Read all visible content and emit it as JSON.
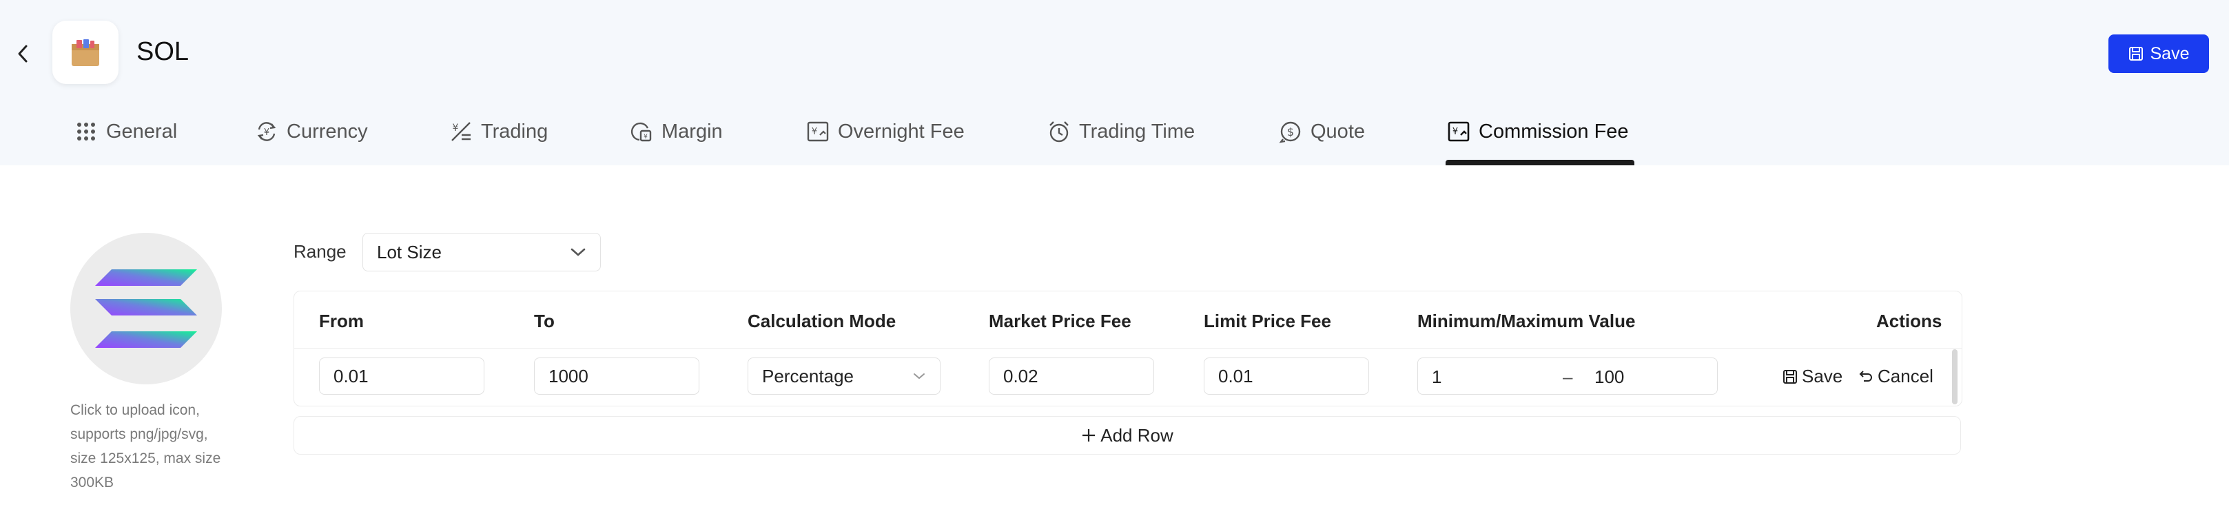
{
  "header": {
    "title": "SOL",
    "save_label": "Save",
    "accent_color": "#1a3cf0"
  },
  "tabs": [
    {
      "label": "General",
      "icon": "grid-icon"
    },
    {
      "label": "Currency",
      "icon": "currency-exchange-icon"
    },
    {
      "label": "Trading",
      "icon": "trading-icon"
    },
    {
      "label": "Margin",
      "icon": "margin-icon"
    },
    {
      "label": "Overnight Fee",
      "icon": "overnight-fee-icon"
    },
    {
      "label": "Trading Time",
      "icon": "alarm-clock-icon"
    },
    {
      "label": "Quote",
      "icon": "quote-icon"
    },
    {
      "label": "Commission Fee",
      "icon": "commission-fee-icon",
      "active": true
    }
  ],
  "logo": {
    "upload_hint": "Click to upload icon, supports png/jpg/svg, size 125x125, max size 300KB"
  },
  "range": {
    "label": "Range",
    "value": "Lot Size"
  },
  "table": {
    "headers": {
      "from": "From",
      "to": "To",
      "calc_mode": "Calculation Mode",
      "market_fee": "Market Price Fee",
      "limit_fee": "Limit Price Fee",
      "minmax": "Minimum/Maximum Value",
      "actions": "Actions"
    },
    "row": {
      "from": "0.01",
      "to": "1000",
      "calc_mode": "Percentage",
      "market_fee": "0.02",
      "limit_fee": "0.01",
      "min": "1",
      "separator": "–",
      "max": "100",
      "save_label": "Save",
      "cancel_label": "Cancel"
    },
    "add_row_label": "Add Row"
  }
}
